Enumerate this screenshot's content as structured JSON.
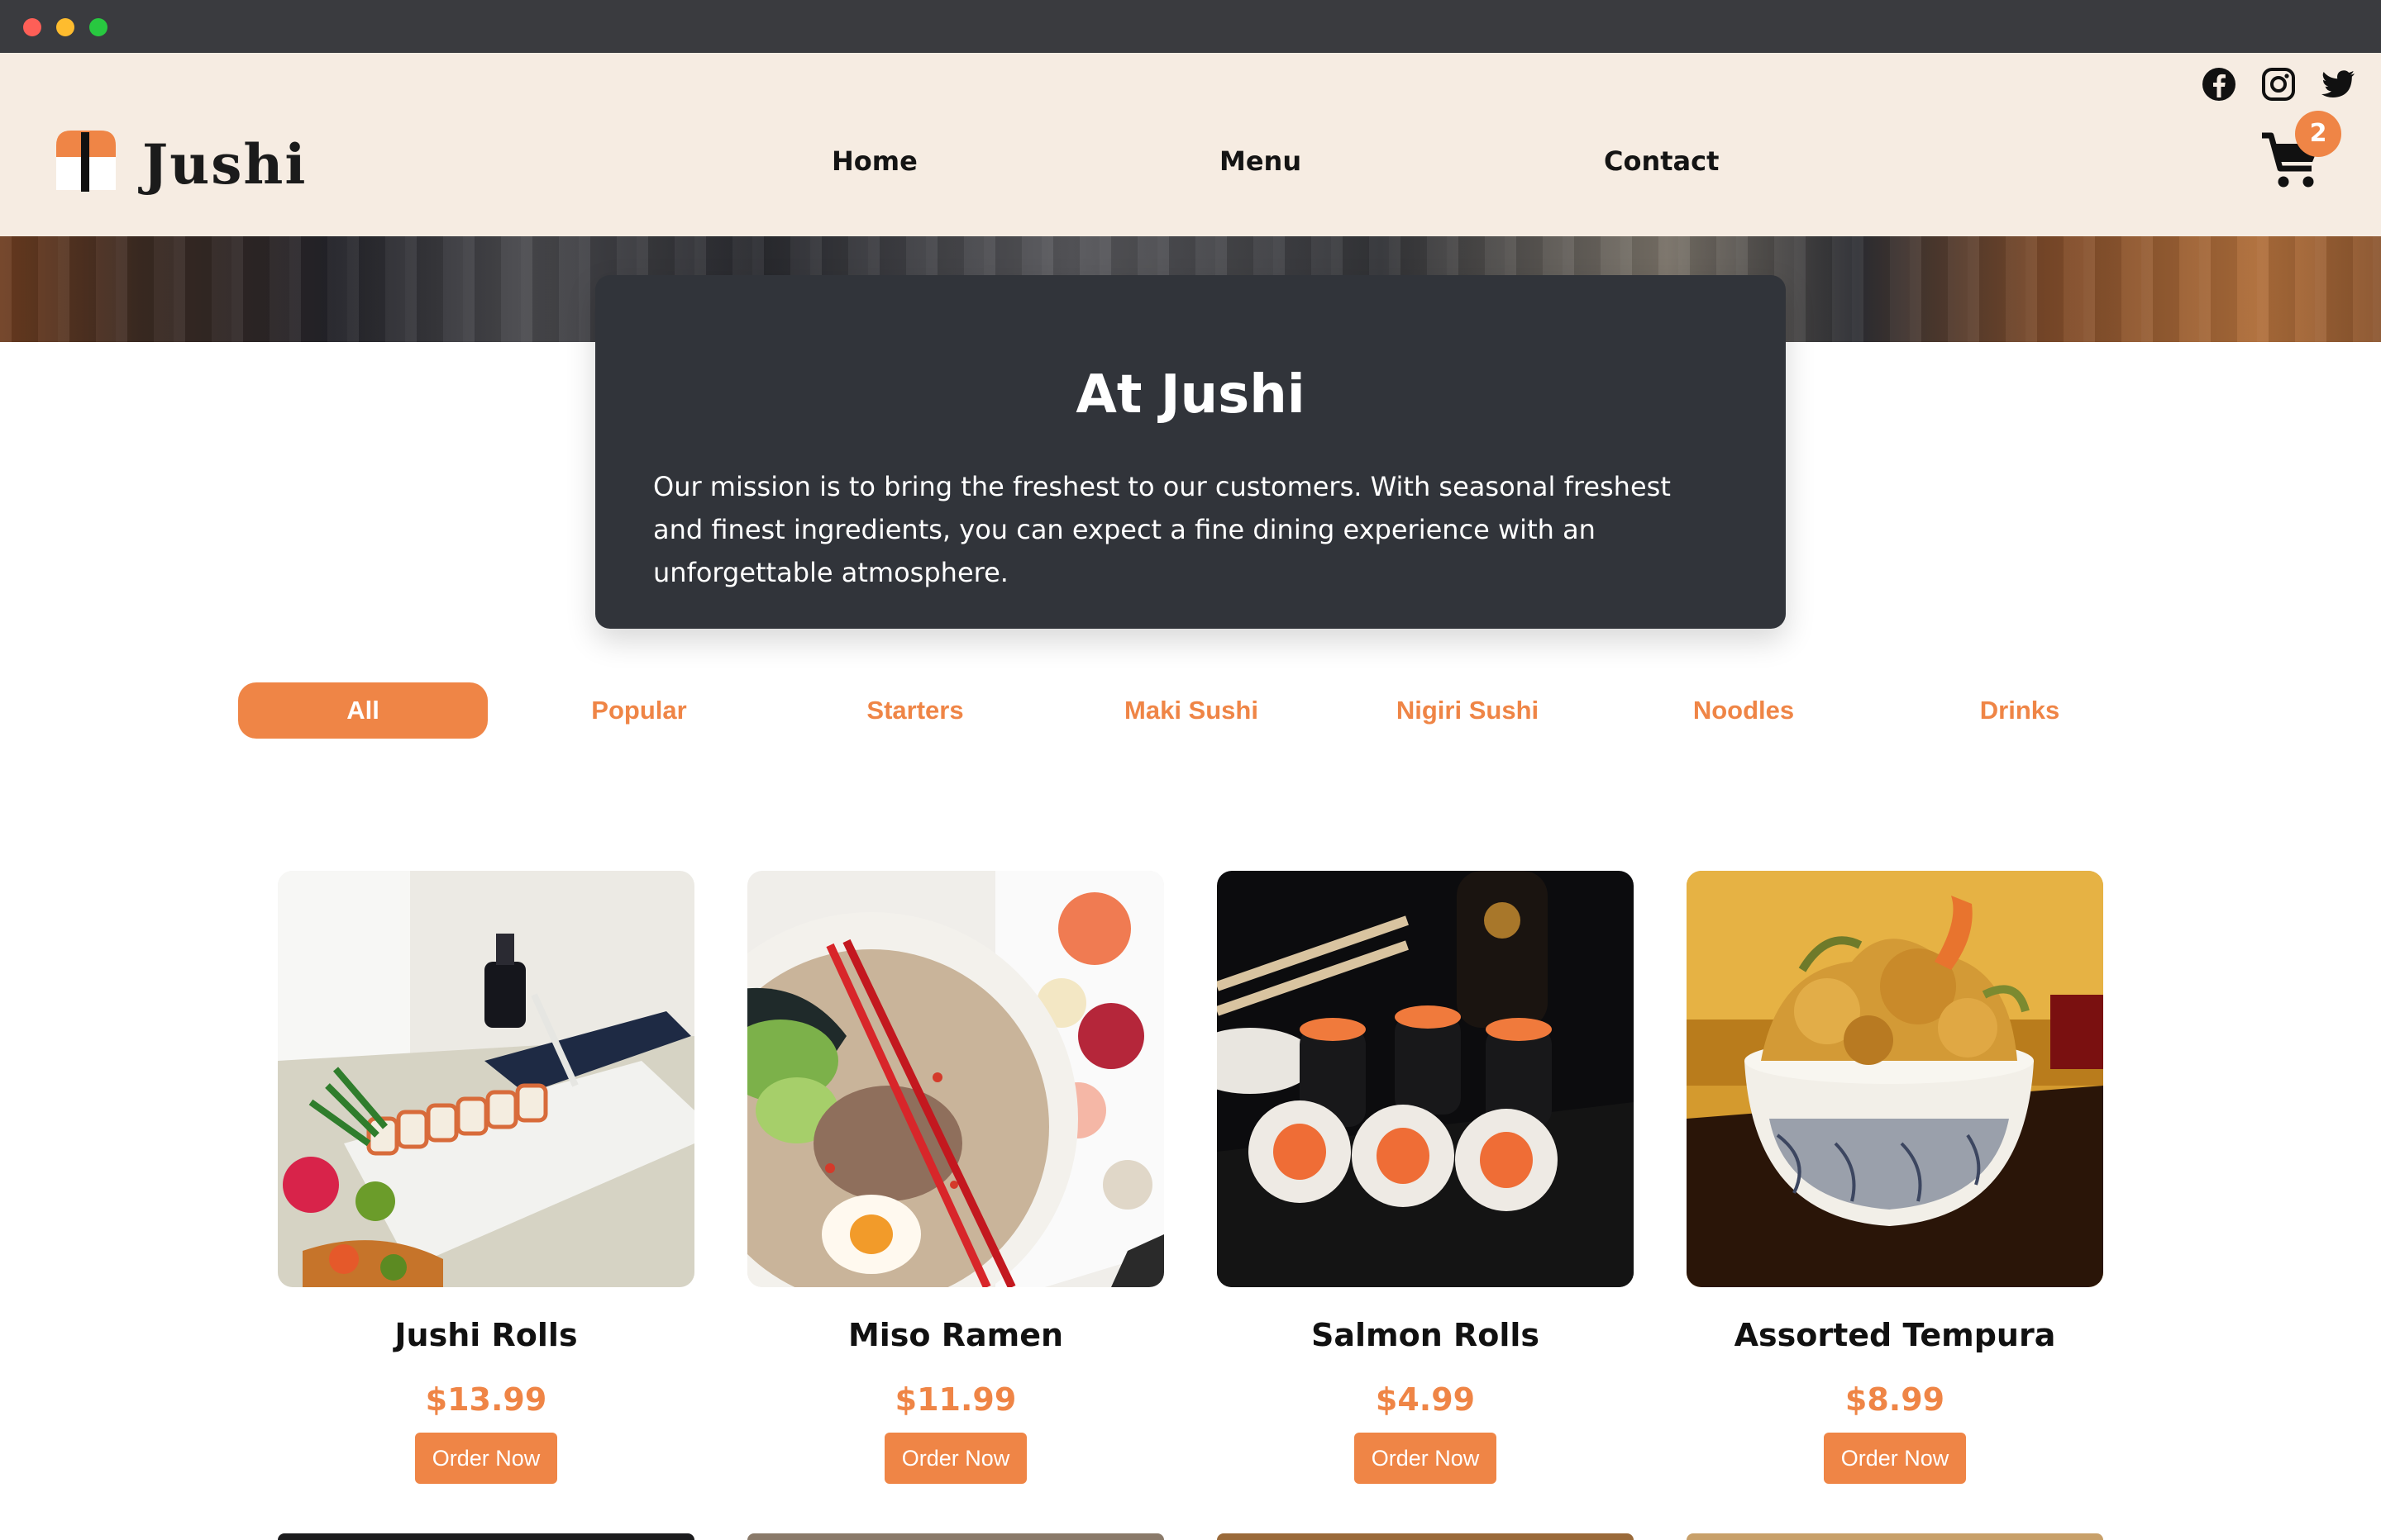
{
  "brand": {
    "name": "Jushi"
  },
  "nav": {
    "home": "Home",
    "menu": "Menu",
    "contact": "Contact"
  },
  "social": [
    "facebook-icon",
    "instagram-icon",
    "twitter-icon"
  ],
  "cart": {
    "count": "2"
  },
  "about": {
    "title": "At Jushi",
    "text": "Our mission is to bring the freshest to our customers. With seasonal freshest and finest ingredients, you can expect a fine dining experience with an unforgettable atmosphere."
  },
  "filters": [
    "All",
    "Popular",
    "Starters",
    "Maki Sushi",
    "Nigiri Sushi",
    "Noodles",
    "Drinks"
  ],
  "active_filter": "All",
  "products": [
    {
      "name": "Jushi Rolls",
      "price": "$13.99",
      "button": "Order Now"
    },
    {
      "name": "Miso Ramen",
      "price": "$11.99",
      "button": "Order Now"
    },
    {
      "name": "Salmon Rolls",
      "price": "$4.99",
      "button": "Order Now"
    },
    {
      "name": "Assorted Tempura",
      "price": "$8.99",
      "button": "Order Now"
    }
  ],
  "colors": {
    "accent": "#ef8546",
    "header_bg": "#f6ece2",
    "card_bg": "#31343a",
    "text": "#141414"
  }
}
